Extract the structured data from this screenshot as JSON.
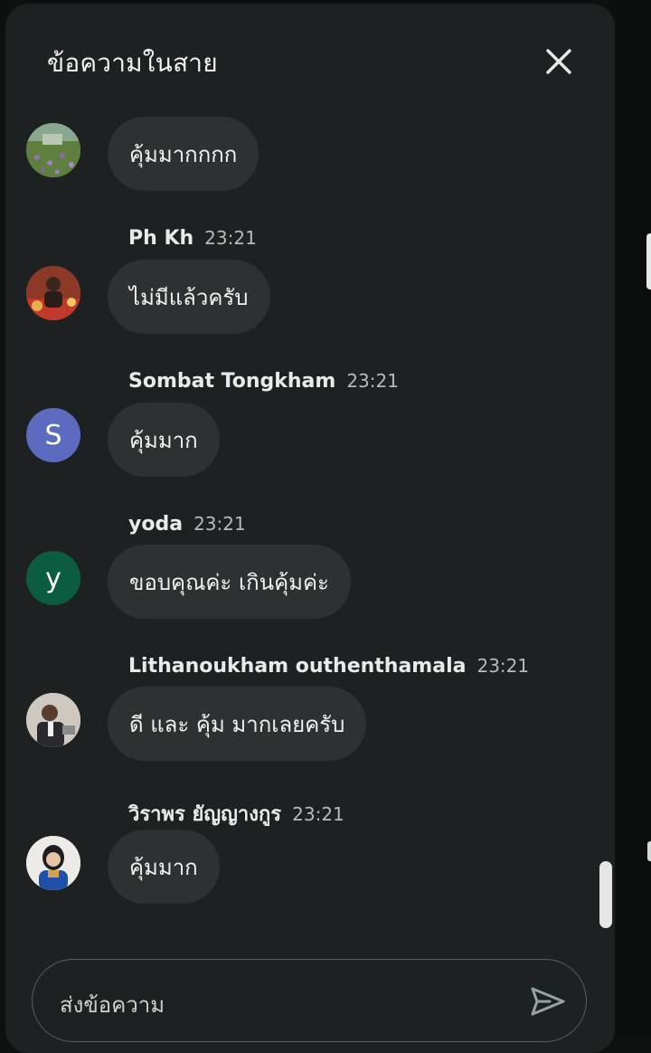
{
  "header": {
    "title": "ข้อความในสาย",
    "close_icon": "close-icon"
  },
  "messages": [
    {
      "author": "",
      "time": "",
      "text": "คุ้มมากกกก",
      "avatar": {
        "type": "photo",
        "icon": "flower-field-avatar"
      }
    },
    {
      "author": "Ph Kh",
      "time": "23:21",
      "text": "ไม่มีแล้วครับ",
      "avatar": {
        "type": "photo",
        "icon": "person-photo-avatar"
      }
    },
    {
      "author": "Sombat Tongkham",
      "time": "23:21",
      "text": "คุ้มมาก",
      "avatar": {
        "type": "letter",
        "letter": "S",
        "color": "#5c6bc0"
      }
    },
    {
      "author": "yoda",
      "time": "23:21",
      "text": "ขอบคุณค่ะ เกินคุ้มค่ะ",
      "avatar": {
        "type": "letter",
        "letter": "y",
        "color": "#0b5c40"
      }
    },
    {
      "author": "Lithanoukham outhenthamala",
      "time": "23:21",
      "text": "ดี และ คุ้ม มากเลยครับ",
      "avatar": {
        "type": "photo",
        "icon": "person-photo-avatar"
      }
    },
    {
      "author": "วิราพร ยัญญางกูร",
      "time": "23:21",
      "text": "คุ้มมาก",
      "avatar": {
        "type": "photo",
        "icon": "person-photo-avatar"
      }
    }
  ],
  "composer": {
    "placeholder": "ส่งข้อความ",
    "send_icon": "send-icon"
  },
  "colors": {
    "panel_bg": "#1e2121",
    "bubble_bg": "#2e3131",
    "text": "#f1f1f1"
  }
}
